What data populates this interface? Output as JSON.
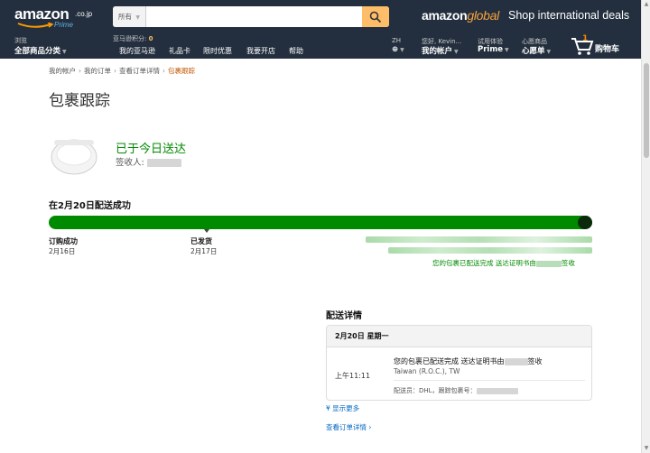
{
  "header": {
    "logo_word": "amazon",
    "logo_tld": ".co.jp",
    "logo_prime": "Prime",
    "search_dept": "所有",
    "search_placeholder": "",
    "global_logo_a": "amazon",
    "global_logo_b": "global",
    "global_deals": "Shop international deals",
    "browse_small": "浏览",
    "browse_bold": "全部商品分类",
    "points_label": "亚马逊积分:",
    "points_value": "0",
    "links": [
      "我的亚马逊",
      "礼品卡",
      "限时优惠",
      "我要开店",
      "帮助"
    ],
    "lang_small": "ZH",
    "greeting": "您好, Kevin...",
    "account": "我的帐户",
    "prime_small": "试用体验",
    "prime": "Prime",
    "wishlist_small": "心愿商品",
    "wishlist": "心愿单",
    "cart_count": "1",
    "cart_label": "购物车"
  },
  "breadcrumb": [
    "我的帐户",
    "我的订单",
    "查看订单详情",
    "包裹跟踪"
  ],
  "page_title": "包裹跟踪",
  "status": {
    "delivered": "已于今日送达",
    "signer_label": "签收人:"
  },
  "tracking": {
    "headline": "在2月20日配送成功",
    "progress": 1.0,
    "milestones": [
      {
        "title": "订购成功",
        "date": "2月16日"
      },
      {
        "title": "已发货",
        "date": "2月17日"
      }
    ],
    "final_message_a": "您的包裹已配送完成 送达证明书由",
    "final_message_b": "签收"
  },
  "details": {
    "title": "配送详情",
    "date_header": "2月20日 星期一",
    "time": "上午11:11",
    "message_a": "您的包裹已配送完成 送达证明书由",
    "message_b": "签收",
    "location": "Taiwan (R.O.C.), TW",
    "carrier": "配送员：DHL，跟踪包裹号："
  },
  "links": {
    "show_more": "显示更多",
    "view_order": "查看订单详情"
  },
  "colors": {
    "nav_bg": "#232f3e",
    "accent": "#febd69",
    "success_green": "#008a00",
    "link_blue": "#0066c0",
    "breadcrumb_current": "#c45500"
  }
}
